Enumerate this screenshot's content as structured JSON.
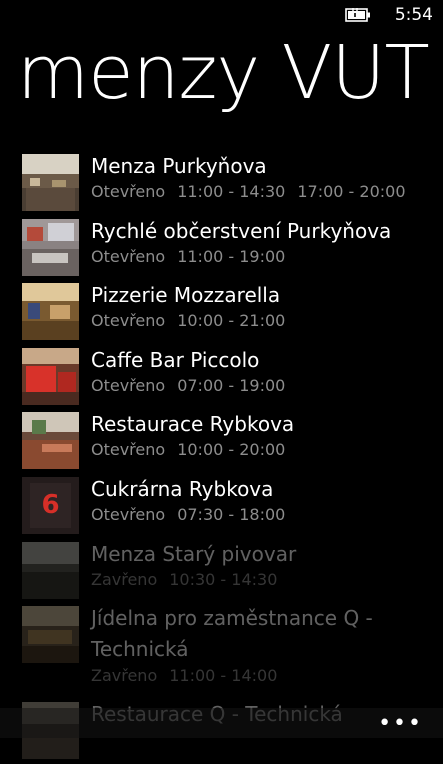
{
  "status": {
    "time": "5:54",
    "battery_icon": "battery-charging-icon"
  },
  "header": {
    "title": "menzy VUT"
  },
  "restaurants": [
    {
      "name": "Menza Purkyňova",
      "state": "Otevřeno",
      "hours1": "11:00 - 14:30",
      "hours2": "17:00 - 20:00",
      "thumb_color": "#6b5a48"
    },
    {
      "name": "Rychlé občerstvení Purkyňova",
      "state": "Otevřeno",
      "hours1": "11:00 - 19:00",
      "hours2": "",
      "thumb_color": "#7a6d66"
    },
    {
      "name": "Pizzerie Mozzarella",
      "state": "Otevřeno",
      "hours1": "10:00 - 21:00",
      "hours2": "",
      "thumb_color": "#8a6a3a"
    },
    {
      "name": "Caffe Bar Piccolo",
      "state": "Otevřeno",
      "hours1": "07:00 - 19:00",
      "hours2": "",
      "thumb_color": "#b03a2a"
    },
    {
      "name": "Restaurace Rybkova",
      "state": "Otevřeno",
      "hours1": "10:00 - 20:00",
      "hours2": "",
      "thumb_color": "#7b5a4a"
    },
    {
      "name": "Cukrárna Rybkova",
      "state": "Otevřeno",
      "hours1": "07:30 - 18:00",
      "hours2": "",
      "thumb_color": "#2a2222",
      "thumb_number": "6"
    },
    {
      "name": "Menza Starý pivovar",
      "state": "Zavřeno",
      "hours1": "10:30 - 14:30",
      "hours2": "",
      "thumb_color": "#5a5a52"
    },
    {
      "name": "Jídelna pro zaměstnance Q - Technická",
      "state": "Zavřeno",
      "hours1": "11:00 - 14:00",
      "hours2": "",
      "thumb_color": "#6a5a44"
    },
    {
      "name": "Restaurace Q - Technická",
      "state": "",
      "hours1": "",
      "hours2": "",
      "thumb_color": "#5a5046"
    }
  ],
  "app_bar": {
    "more_label": "•••"
  }
}
